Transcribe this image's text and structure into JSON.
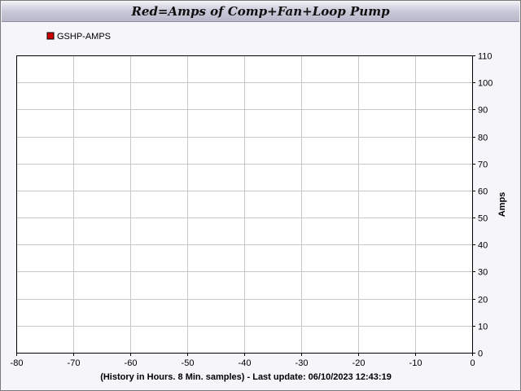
{
  "chart_data": {
    "type": "line",
    "title": "Red=Amps of Comp+Fan+Loop Pump",
    "xlabel": "(History in Hours. 8 Min. samples) - Last update: 06/10/2023 12:43:19",
    "ylabel": "Amps",
    "xlim": [
      -80,
      0
    ],
    "ylim": [
      0,
      110
    ],
    "x_ticks": [
      -80,
      -70,
      -60,
      -50,
      -40,
      -30,
      -20,
      -10,
      0
    ],
    "y_ticks": [
      0,
      10,
      20,
      30,
      40,
      50,
      60,
      70,
      80,
      90,
      100,
      110
    ],
    "grid": true,
    "legend_position": "top-left",
    "y_axis_side": "right",
    "series": [
      {
        "name": "GSHP-AMPS",
        "color": "#cc0000",
        "x": [],
        "y": []
      }
    ]
  },
  "colors": {
    "plot_background": "#ffffff",
    "grid": "#c8c8c8",
    "axis": "#000000",
    "frame_background": "#f5f5fa"
  }
}
